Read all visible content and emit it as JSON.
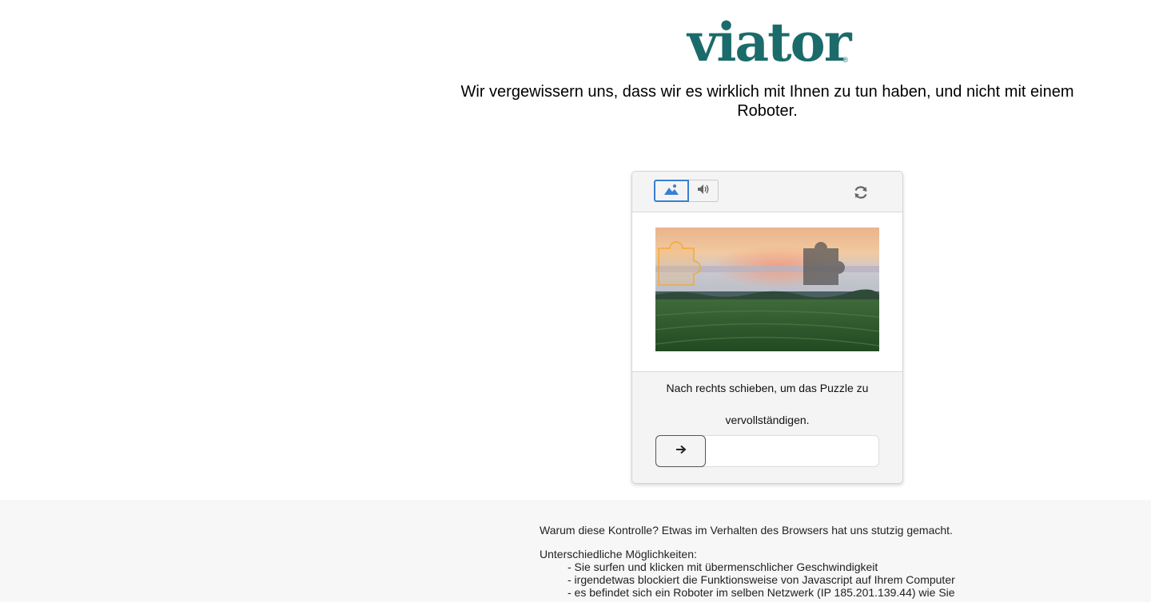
{
  "brand": {
    "logo_text": "viator",
    "registered": "®",
    "color": "#1b6b6b"
  },
  "headline": "Wir vergewissern uns, dass wir es wirklich mit Ihnen zu tun haben, und nicht mit einem Roboter.",
  "captcha": {
    "modes": [
      {
        "name": "image",
        "icon": "image-icon",
        "selected": true
      },
      {
        "name": "audio",
        "icon": "speaker-icon",
        "selected": false
      }
    ],
    "refresh_icon": "refresh-icon",
    "puzzle_image": {
      "description_icon": "sunset-field-image",
      "piece_icon": "puzzle-piece-icon"
    },
    "instruction": "Nach rechts schieben, um das Puzzle zu vervollständigen.",
    "slider": {
      "handle_icon": "arrow-right-icon",
      "progress": 0
    },
    "accent_color": "#3b7fd0"
  },
  "footer": {
    "why": "Warum diese Kontrolle? Etwas im Verhalten des Browsers hat uns stutzig gemacht.",
    "possibilities_title": "Unterschiedliche Möglichkeiten:",
    "possibilities": [
      "- Sie surfen und klicken mit übermenschlicher Geschwindigkeit",
      "- irgendetwas blockiert die Funktionsweise von Javascript auf Ihrem Computer",
      "- es befindet sich ein Roboter im selben Netzwerk (IP 185.201.139.44) wie Sie"
    ]
  }
}
